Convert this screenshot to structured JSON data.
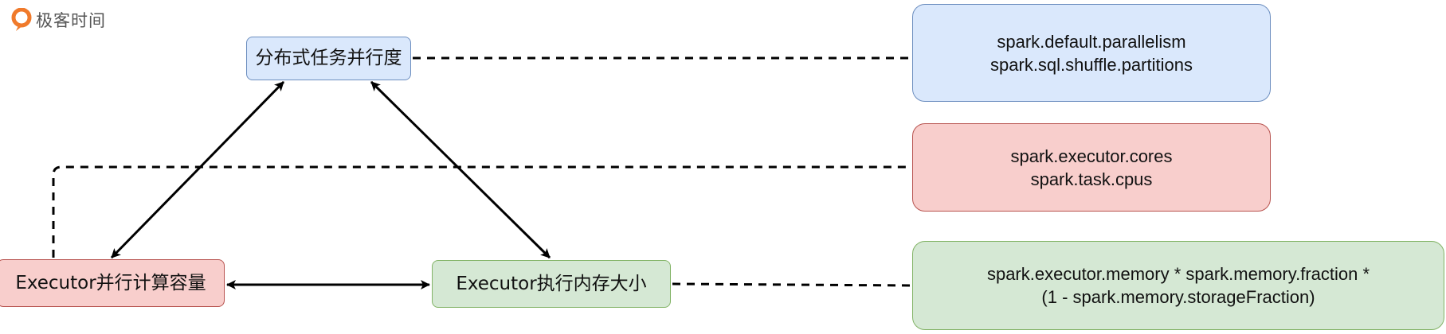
{
  "brand": {
    "name": "极客时间",
    "color": "#f07a2b"
  },
  "nodes": {
    "task_parallelism": {
      "label": "分布式任务并行度"
    },
    "executor_capacity": {
      "label": "Executor并行计算容量"
    },
    "executor_memory": {
      "label": "Executor执行内存大小"
    }
  },
  "configs": {
    "task_parallelism": {
      "lines": [
        "spark.default.parallelism",
        "spark.sql.shuffle.partitions"
      ]
    },
    "executor_capacity": {
      "lines": [
        "spark.executor.cores",
        "spark.task.cpus"
      ]
    },
    "executor_memory": {
      "lines": [
        "spark.executor.memory * spark.memory.fraction *",
        "(1 - spark.memory.storageFraction)"
      ]
    }
  },
  "colors": {
    "blue_fill": "#dae8fc",
    "blue_border": "#6c8ebf",
    "red_fill": "#f8cecc",
    "red_border": "#b85450",
    "green_fill": "#d5e8d4",
    "green_border": "#82b366",
    "line": "#000000"
  }
}
